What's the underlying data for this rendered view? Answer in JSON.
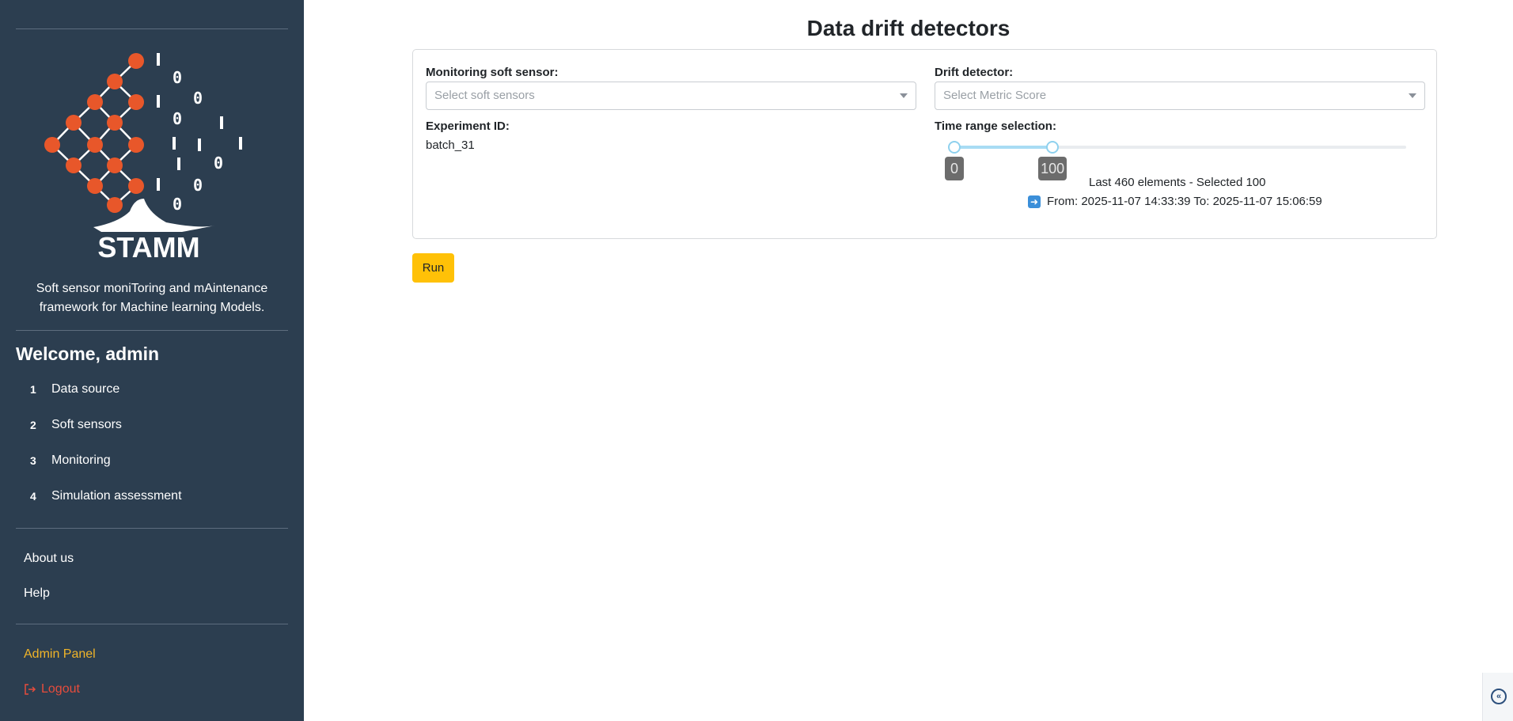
{
  "sidebar": {
    "brand": "STAMM",
    "tagline_line1": "Soft sensor moniToring and mAintenance",
    "tagline_line2": "framework for Machine learning Models.",
    "welcome": "Welcome, admin",
    "nav": [
      {
        "num": "1",
        "label": "Data source"
      },
      {
        "num": "2",
        "label": "Soft sensors"
      },
      {
        "num": "3",
        "label": "Monitoring"
      },
      {
        "num": "4",
        "label": "Simulation assessment"
      }
    ],
    "about": "About us",
    "help": "Help",
    "admin": "Admin Panel",
    "logout": "Logout",
    "colors": {
      "background": "#2c3e50",
      "accent_dot": "#e8572a",
      "admin": "#f0b429",
      "logout": "#e74c3c"
    }
  },
  "main": {
    "title": "Data drift detectors",
    "monitoring_label": "Monitoring soft sensor:",
    "monitoring_placeholder": "Select soft sensors",
    "drift_label": "Drift detector:",
    "drift_placeholder": "Select Metric Score",
    "experiment_label": "Experiment ID:",
    "experiment_value": "batch_31",
    "time_label": "Time range selection:",
    "slider": {
      "min": 0,
      "max": 460,
      "low": 0,
      "high": 100,
      "low_label": "0",
      "high_label": "100"
    },
    "elements_info": "Last 460 elements - Selected 100",
    "range_info": "From: 2025-11-07 14:33:39 To: 2025-11-07 15:06:59",
    "arrow_icon": "right-arrow-icon",
    "run_label": "Run"
  }
}
